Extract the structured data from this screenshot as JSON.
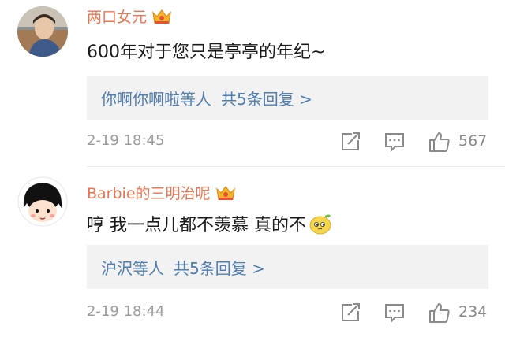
{
  "comments": [
    {
      "username": "两口女元",
      "text": "600年对于您只是亭亭的年纪~",
      "reply_users": "你啊你啊啦等人",
      "reply_count": "共5条回复 >",
      "time": "2-19 18:45",
      "likes": "567"
    },
    {
      "username": "Barbie的三明治呢",
      "text": "哼 我一点儿都不羡慕 真的不",
      "reply_users": "沪沢等人",
      "reply_count": "共5条回复 >",
      "time": "2-19 18:44",
      "likes": "234"
    }
  ],
  "icons": {
    "vip": "crown-icon",
    "share": "share-icon",
    "comment": "comment-icon",
    "like": "thumbs-up-icon",
    "emoji": "lemon-emoji-icon"
  },
  "colors": {
    "username": "#eb7350",
    "link": "#507daf",
    "meta": "#9b9b9b",
    "reply_bg": "#f2f2f2"
  }
}
